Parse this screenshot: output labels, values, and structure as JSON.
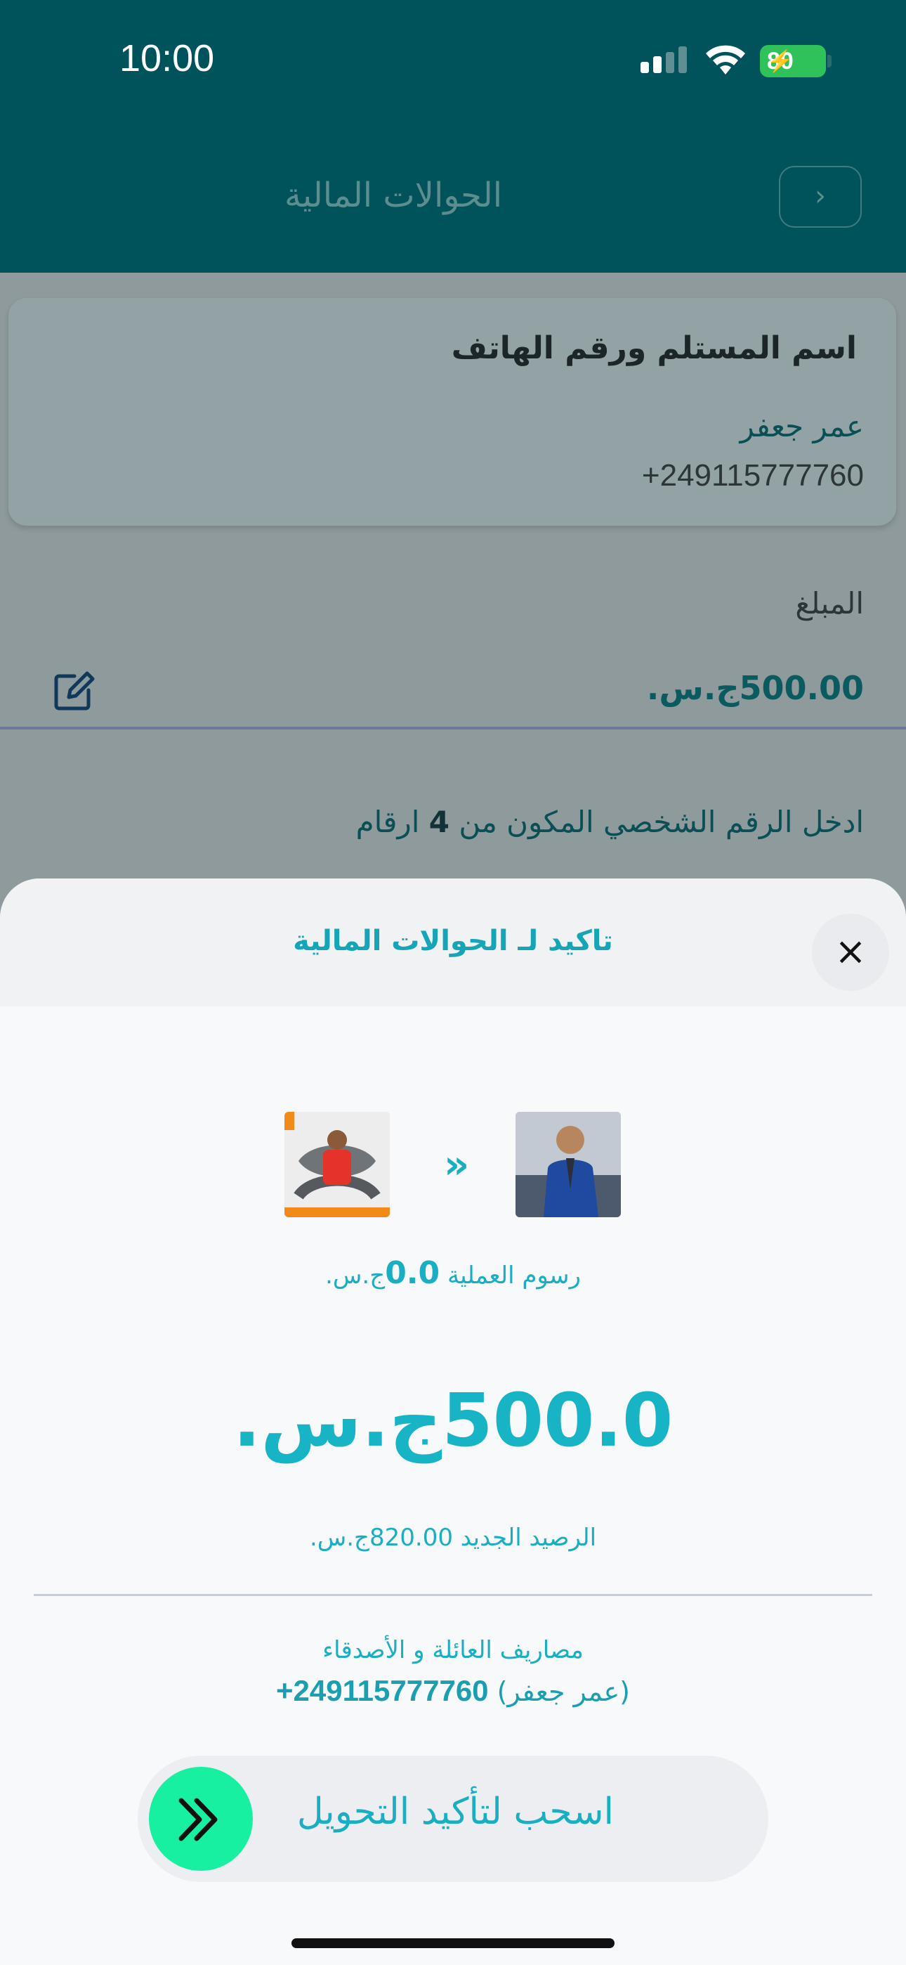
{
  "status_bar": {
    "time": "10:00",
    "battery": "80"
  },
  "header": {
    "title": "الحوالات المالية",
    "back_icon": "chevron-right"
  },
  "recipient_card": {
    "label": "اسم المستلم ورقم الهاتف",
    "name": "عمر جعفر",
    "phone": "249115777760+"
  },
  "amount_section": {
    "label": "المبلغ",
    "value": "500.00ج.س."
  },
  "pin_hint": {
    "prefix": "ادخل الرقم الشخصي المكون من ",
    "digits": "4",
    "suffix": " ارقام"
  },
  "sheet": {
    "title": "تاكيد لـ الحوالات المالية",
    "fees_label": "رسوم العملية ",
    "fees_value": "0.0",
    "fees_currency": "ج.س.",
    "amount": "500.0ج.س.",
    "new_balance": "الرصيد الجديد 820.00ج.س.",
    "purpose": "مصاريف العائلة و الأصدقاء",
    "recipient_name": "(عمر جعفر) ",
    "recipient_phone": "249115777760+",
    "slide_label": "اسحب لتأكيد التحويل"
  },
  "colors": {
    "header": "#00535b",
    "accent": "#16b4c5",
    "knob": "#16f0a0"
  }
}
